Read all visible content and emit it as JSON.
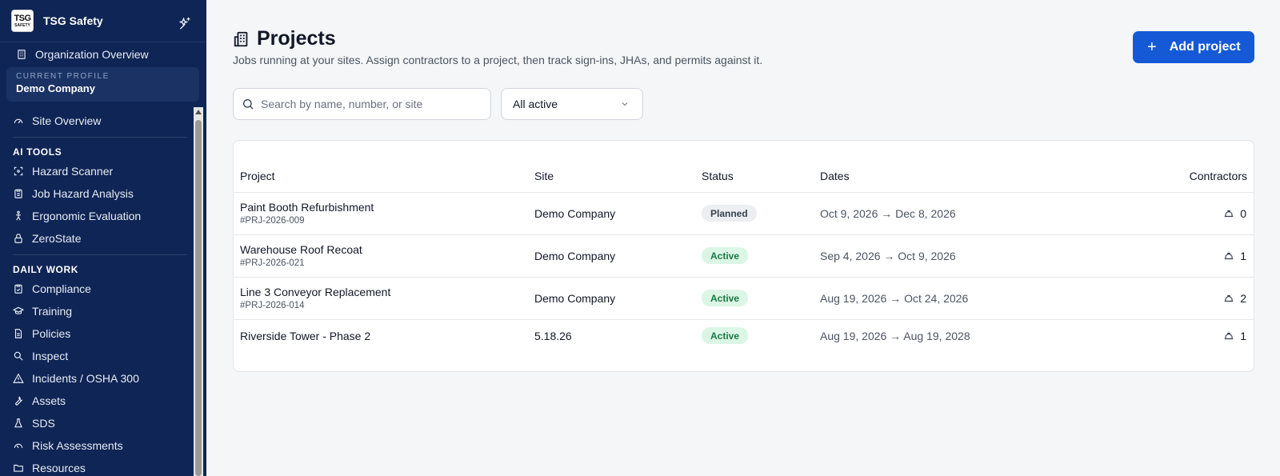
{
  "sidebar": {
    "logo_top": "TSG",
    "logo_bottom": "SAFETY",
    "brand": "TSG Safety",
    "org_overview": "Organization Overview",
    "profile_label": "CURRENT PROFILE",
    "profile_value": "Demo Company",
    "site_overview": "Site Overview",
    "section_ai": "AI TOOLS",
    "ai_items": [
      {
        "label": "Hazard Scanner",
        "icon": "scan-icon"
      },
      {
        "label": "Job Hazard Analysis",
        "icon": "clipboard-icon"
      },
      {
        "label": "Ergonomic Evaluation",
        "icon": "person-icon"
      },
      {
        "label": "ZeroState",
        "icon": "lock-icon"
      }
    ],
    "section_daily": "DAILY WORK",
    "daily_items": [
      {
        "label": "Compliance",
        "icon": "clipboard-check-icon"
      },
      {
        "label": "Training",
        "icon": "graduation-cap-icon"
      },
      {
        "label": "Policies",
        "icon": "document-icon"
      },
      {
        "label": "Inspect",
        "icon": "magnifier-icon"
      },
      {
        "label": "Incidents / OSHA 300",
        "icon": "warning-icon"
      },
      {
        "label": "Assets",
        "icon": "wrench-icon"
      },
      {
        "label": "SDS",
        "icon": "flask-icon"
      },
      {
        "label": "Risk Assessments",
        "icon": "gauge-icon"
      },
      {
        "label": "Resources",
        "icon": "folder-icon"
      }
    ]
  },
  "header": {
    "title": "Projects",
    "subtitle": "Jobs running at your sites. Assign contractors to a project, then track sign-ins, JHAs, and permits against it.",
    "add_button": "Add project"
  },
  "filters": {
    "search_placeholder": "Search by name, number, or site",
    "status_select": "All active"
  },
  "table": {
    "headers": {
      "project": "Project",
      "site": "Site",
      "status": "Status",
      "dates": "Dates",
      "contractors": "Contractors"
    },
    "rows": [
      {
        "name": "Paint Booth Refurbishment",
        "number": "#PRJ-2026-009",
        "site": "Demo Company",
        "status": "Planned",
        "dates": "Oct 9, 2026 → Dec 8, 2026",
        "contractors": "0"
      },
      {
        "name": "Warehouse Roof Recoat",
        "number": "#PRJ-2026-021",
        "site": "Demo Company",
        "status": "Active",
        "dates": "Sep 4, 2026 → Oct 9, 2026",
        "contractors": "1"
      },
      {
        "name": "Line 3 Conveyor Replacement",
        "number": "#PRJ-2026-014",
        "site": "Demo Company",
        "status": "Active",
        "dates": "Aug 19, 2026 → Oct 24, 2026",
        "contractors": "2"
      },
      {
        "name": "Riverside Tower - Phase 2",
        "number": "",
        "site": "5.18.26",
        "status": "Active",
        "dates": "Aug 19, 2026 → Aug 19, 2028",
        "contractors": "1"
      }
    ]
  },
  "colors": {
    "sidebar_bg": "#0f2555",
    "accent": "#1559d6",
    "active_badge_bg": "#dcf6e6",
    "active_badge_text": "#157a43",
    "planned_badge_bg": "#eceef1"
  }
}
